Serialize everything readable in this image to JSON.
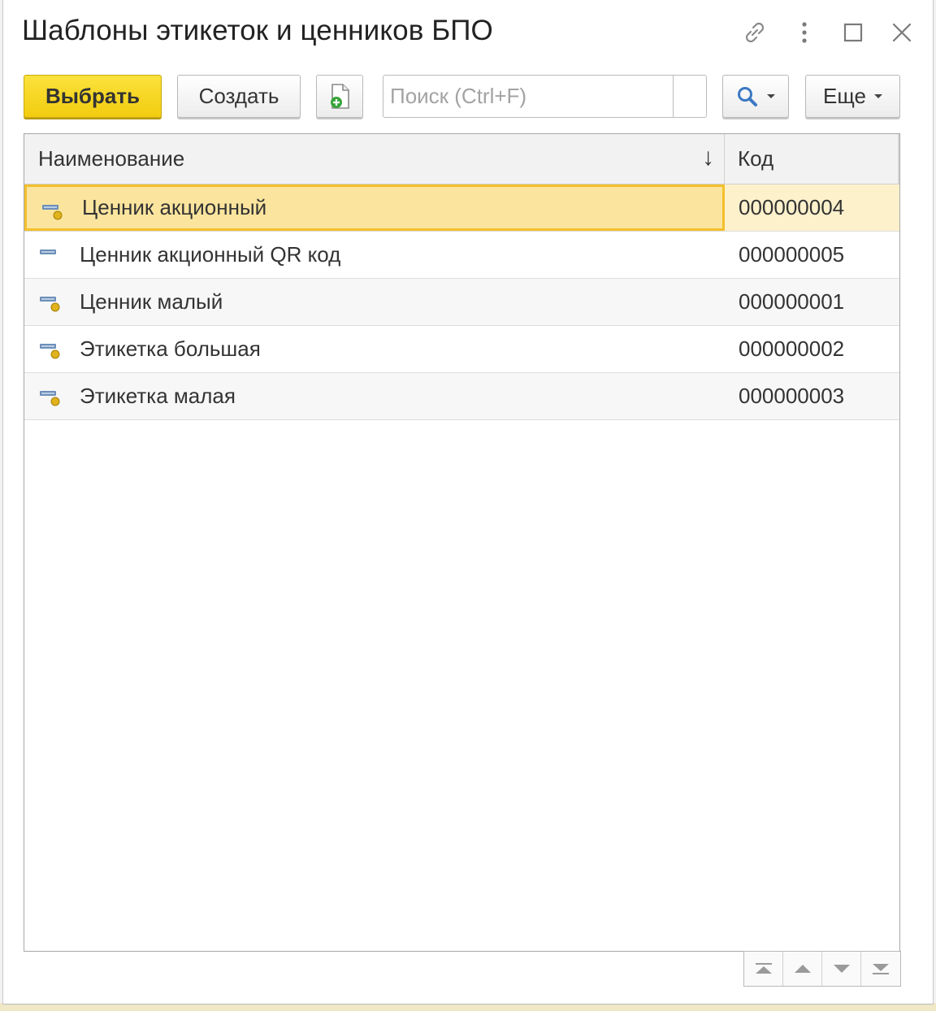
{
  "window": {
    "title": "Шаблоны этикеток и ценников БПО",
    "controls": {
      "link_icon": "link-icon",
      "more_icon": "kebab-menu-icon",
      "maximize_icon": "maximize-icon",
      "close_icon": "close-icon"
    }
  },
  "toolbar": {
    "select_label": "Выбрать",
    "create_label": "Создать",
    "copy_icon": "create-copy-icon",
    "search_placeholder": "Поиск (Ctrl+F)",
    "search_value": "",
    "search_icon": "magnifier-icon",
    "more_label": "Еще"
  },
  "table": {
    "columns": [
      {
        "label": "Наименование",
        "sort": "descending-arrow"
      },
      {
        "label": "Код"
      }
    ],
    "sort_indicator": "↓",
    "rows": [
      {
        "name": "Ценник акционный",
        "code": "000000004",
        "icon": "template-used-icon",
        "selected": true
      },
      {
        "name": "Ценник акционный QR код",
        "code": "000000005",
        "icon": "template-plain-icon",
        "selected": false
      },
      {
        "name": "Ценник малый",
        "code": "000000001",
        "icon": "template-used-icon",
        "selected": false
      },
      {
        "name": "Этикетка большая",
        "code": "000000002",
        "icon": "template-used-icon",
        "selected": false
      },
      {
        "name": "Этикетка малая",
        "code": "000000003",
        "icon": "template-used-icon",
        "selected": false
      }
    ]
  },
  "navigation": {
    "icons": [
      "go-first-icon",
      "go-up-icon",
      "go-down-icon",
      "go-last-icon"
    ]
  },
  "colors": {
    "primary_button": "#f6d21c",
    "selected_row": "#fbe59e",
    "selected_border": "#f2c02c"
  }
}
